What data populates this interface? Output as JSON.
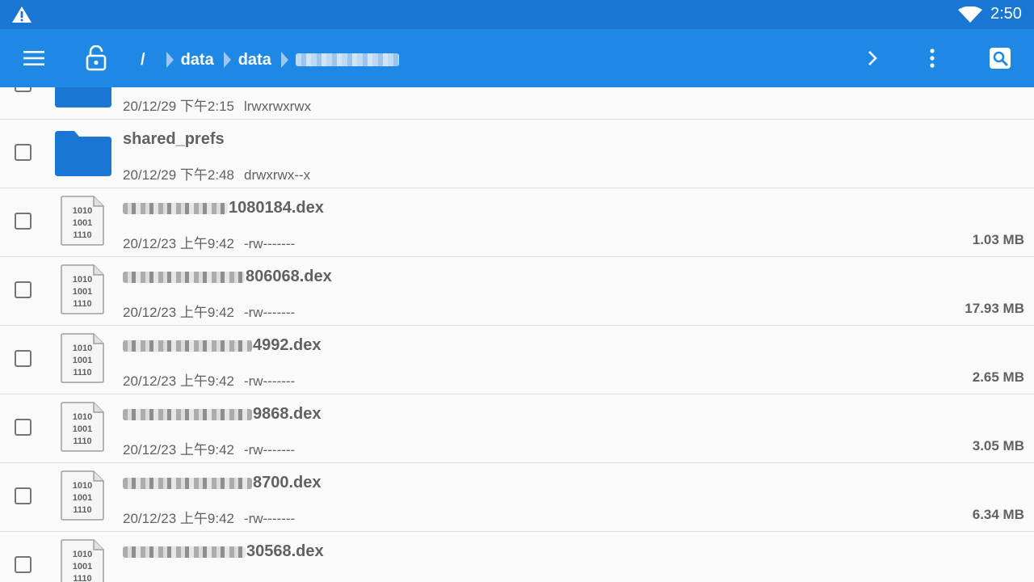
{
  "status_bar": {
    "time": "2:50",
    "warning_icon": "warning-triangle-icon",
    "wifi_icon": "wifi-icon"
  },
  "toolbar": {
    "menu_icon": "hamburger-menu-icon",
    "lock_icon": "unlock-icon",
    "breadcrumbs": [
      "/",
      "data",
      "data"
    ],
    "forward_icon": "chevron-right-icon",
    "more_icon": "more-vertical-icon",
    "search_icon": "search-icon"
  },
  "colors": {
    "statusbar": "#1976d2",
    "toolbar": "#1e88e5",
    "folder": "#1976d2",
    "underline": "#1565c0"
  },
  "files": [
    {
      "type": "folder",
      "name": "",
      "date": "20/12/29 下午2:15",
      "perms": "lrwxrwxrwx",
      "size": ""
    },
    {
      "type": "folder",
      "name": "shared_prefs",
      "date": "20/12/29 下午2:48",
      "perms": "drwxrwx--x",
      "size": ""
    },
    {
      "type": "dex",
      "name_visible": "1080184.dex",
      "date": "20/12/23 上午9:42",
      "perms": "-rw-------",
      "size": "1.03 MB"
    },
    {
      "type": "dex",
      "name_visible": "806068.dex",
      "date": "20/12/23 上午9:42",
      "perms": "-rw-------",
      "size": "17.93 MB"
    },
    {
      "type": "dex",
      "name_visible": "4992.dex",
      "date": "20/12/23 上午9:42",
      "perms": "-rw-------",
      "size": "2.65 MB"
    },
    {
      "type": "dex",
      "name_visible": "9868.dex",
      "date": "20/12/23 上午9:42",
      "perms": "-rw-------",
      "size": "3.05 MB"
    },
    {
      "type": "dex",
      "name_visible": "8700.dex",
      "date": "20/12/23 上午9:42",
      "perms": "-rw-------",
      "size": "6.34 MB"
    },
    {
      "type": "dex",
      "name_visible": "30568.dex",
      "date": "",
      "perms": "",
      "size": ""
    }
  ],
  "dex_icon_text": [
    "1010",
    "1001",
    "1110"
  ]
}
